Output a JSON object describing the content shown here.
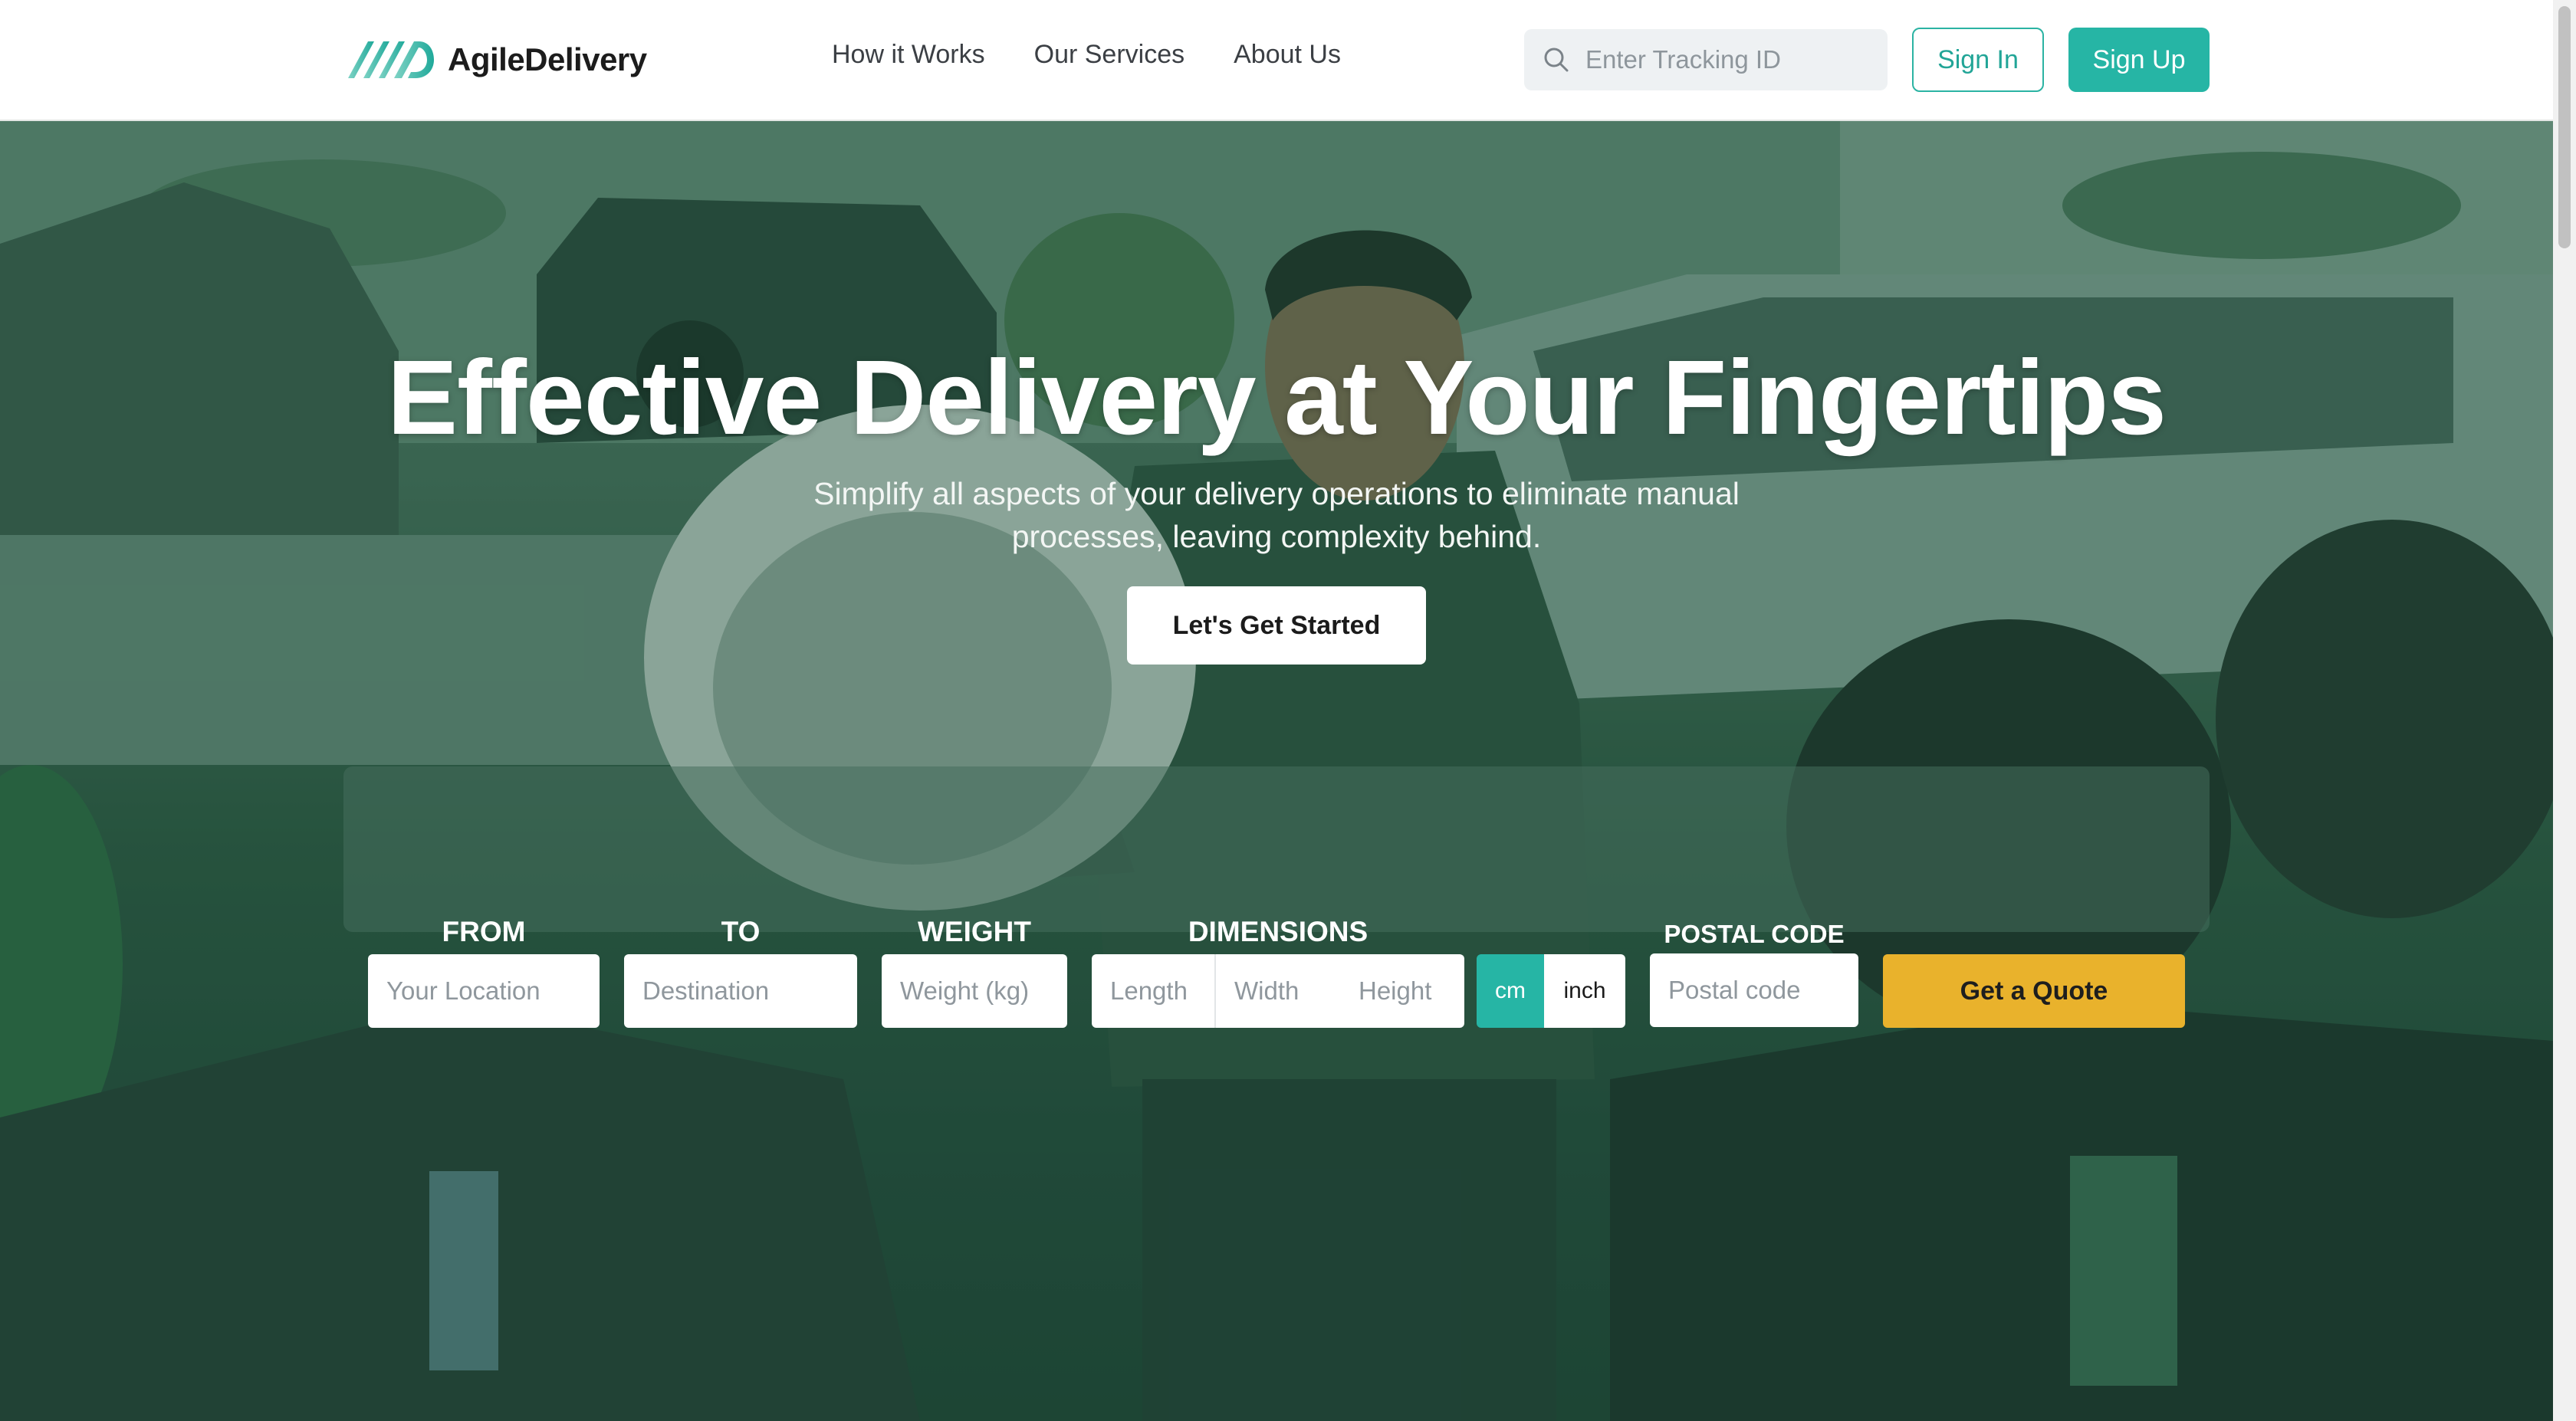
{
  "brand": {
    "name": "AgileDelivery",
    "accent": "#26b5a5",
    "quote_button_color": "#e9b22c"
  },
  "nav": {
    "items": [
      "How it Works",
      "Our Services",
      "About Us"
    ]
  },
  "search": {
    "placeholder": "Enter Tracking ID",
    "icon": "search-icon"
  },
  "auth": {
    "sign_in": "Sign In",
    "sign_up": "Sign Up"
  },
  "hero": {
    "title": "Effective Delivery at Your Fingertips",
    "subtitle": "Simplify all aspects of your delivery operations to eliminate manual processes, leaving complexity behind.",
    "cta": "Let's Get Started"
  },
  "quote": {
    "from_label": "FROM",
    "from_placeholder": "Your Location",
    "to_label": "TO",
    "to_placeholder": "Destination",
    "weight_label": "WEIGHT",
    "weight_placeholder": "Weight (kg)",
    "dimensions_label": "DIMENSIONS",
    "length_placeholder": "Length",
    "width_placeholder": "Width",
    "height_placeholder": "Height",
    "unit_cm": "cm",
    "unit_inch": "inch",
    "selected_unit": "cm",
    "postal_label": "POSTAL CODE",
    "postal_placeholder": "Postal code",
    "submit": "Get a Quote"
  }
}
